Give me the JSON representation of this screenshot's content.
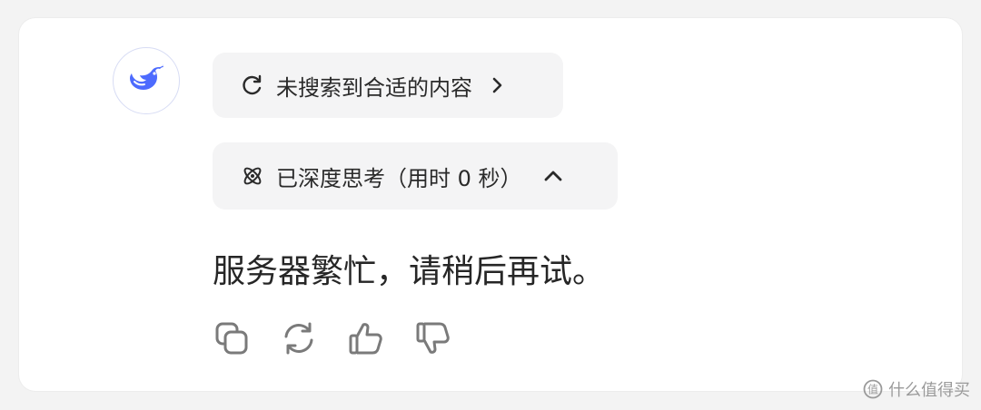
{
  "search_pill": {
    "label": "未搜索到合适的内容",
    "icon": "search-refresh-icon",
    "chevron": "chevron-right-icon"
  },
  "think_pill": {
    "label": "已深度思考（用时 0 秒）",
    "icon": "atom-icon",
    "chevron": "chevron-up-icon"
  },
  "message": {
    "text": "服务器繁忙，请稍后再试。"
  },
  "actions": [
    {
      "name": "copy",
      "icon": "copy-icon"
    },
    {
      "name": "regenerate",
      "icon": "refresh-icon"
    },
    {
      "name": "like",
      "icon": "thumbs-up-icon"
    },
    {
      "name": "dislike",
      "icon": "thumbs-down-icon"
    }
  ],
  "watermark": {
    "text": "什么值得买"
  },
  "colors": {
    "brand": "#4d6bfe",
    "pill_bg": "#f4f4f5",
    "icon_gray": "#7a7a7a"
  }
}
